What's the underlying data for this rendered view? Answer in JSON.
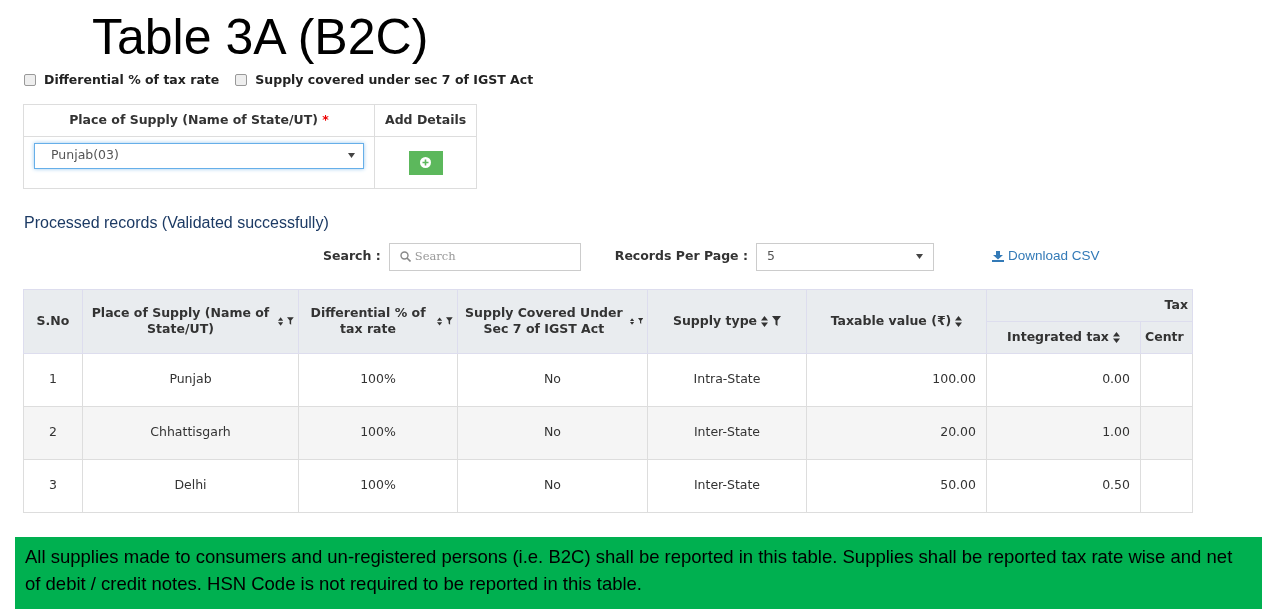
{
  "title": "Table 3A (B2C)",
  "options": [
    {
      "label": "Differential % of tax rate",
      "checked": false
    },
    {
      "label": "Supply covered under sec 7 of IGST Act",
      "checked": false
    }
  ],
  "entry_form": {
    "columns": [
      {
        "label": "Place of Supply (Name of State/UT)",
        "required_marker": "*"
      },
      {
        "label": "Add Details"
      }
    ],
    "place_of_supply": {
      "value": "Punjab(03)"
    }
  },
  "records_heading": "Processed records (Validated successfully)",
  "search": {
    "label": "Search :",
    "placeholder": "Search"
  },
  "records_per_page": {
    "label": "Records Per Page :",
    "value": "5"
  },
  "download": "Download CSV",
  "table": {
    "columns": [
      {
        "label": "S.No",
        "sortable": false,
        "filterable": false
      },
      {
        "label": "Place of Supply (Name of State/UT)",
        "sortable": true,
        "filterable": true
      },
      {
        "label": "Differential % of tax rate",
        "sortable": true,
        "filterable": true
      },
      {
        "label": "Supply Covered Under Sec 7 of IGST Act",
        "sortable": true,
        "filterable": true
      },
      {
        "label": "Supply type",
        "sortable": true,
        "filterable": true
      },
      {
        "label": "Taxable value (₹)",
        "sortable": true,
        "filterable": false
      }
    ],
    "group_header": "Tax",
    "sub_columns": [
      {
        "label": "Integrated tax",
        "sortable": true
      },
      {
        "label": "Centr",
        "sortable": false
      }
    ],
    "rows": [
      [
        "1",
        "Punjab",
        "100%",
        "No",
        "Intra-State",
        "100.00",
        "0.00"
      ],
      [
        "2",
        "Chhattisgarh",
        "100%",
        "No",
        "Inter-State",
        "20.00",
        "1.00"
      ],
      [
        "3",
        "Delhi",
        "100%",
        "No",
        "Inter-State",
        "50.00",
        "0.50"
      ]
    ]
  },
  "note": "All supplies made to consumers and un-registered persons (i.e. B2C) shall be reported in this table. Supplies shall be reported tax rate wise and net of debit / credit notes. HSN Code is not required to be reported in this table."
}
